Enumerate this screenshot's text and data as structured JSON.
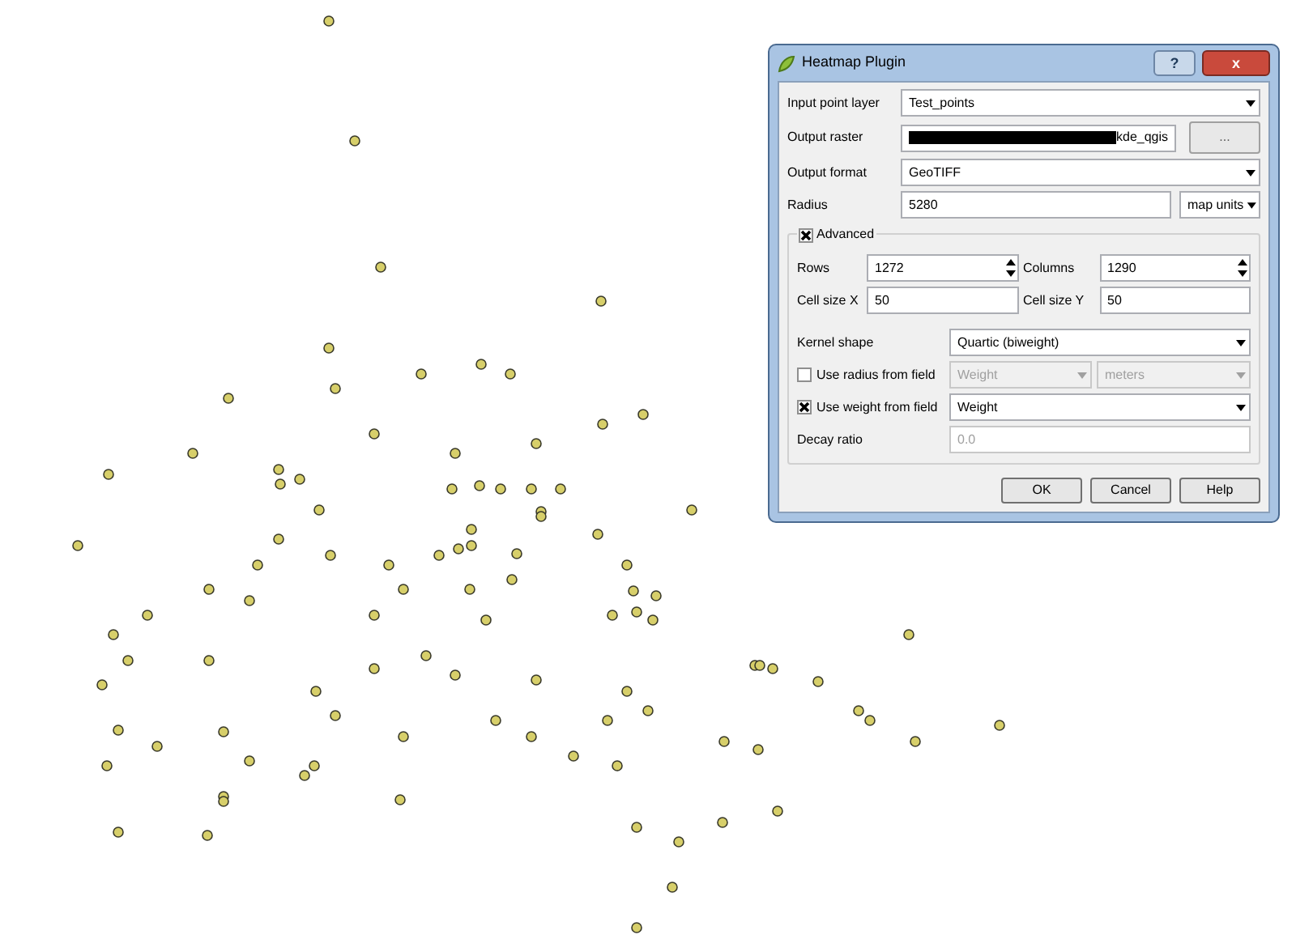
{
  "dialog": {
    "title": "Heatmap Plugin",
    "help_button": "?",
    "close_button": "x",
    "input_layer": {
      "label": "Input point layer",
      "value": "Test_points"
    },
    "output_raster": {
      "label": "Output raster",
      "value": "kde_qgis",
      "browse": "..."
    },
    "output_format": {
      "label": "Output format",
      "value": "GeoTIFF"
    },
    "radius": {
      "label": "Radius",
      "value": "5280",
      "units": "map units"
    },
    "advanced": {
      "label": "Advanced",
      "checked": true,
      "rows": {
        "label": "Rows",
        "value": "1272"
      },
      "columns": {
        "label": "Columns",
        "value": "1290"
      },
      "cell_x": {
        "label": "Cell size X",
        "value": "50"
      },
      "cell_y": {
        "label": "Cell size Y",
        "value": "50"
      },
      "kernel_shape": {
        "label": "Kernel shape",
        "value": "Quartic (biweight)"
      },
      "radius_field": {
        "label": "Use radius from field",
        "checked": false,
        "field": "Weight",
        "units": "meters"
      },
      "weight_field": {
        "label": "Use weight from field",
        "checked": true,
        "field": "Weight"
      },
      "decay_ratio": {
        "label": "Decay ratio",
        "value": "0.0",
        "disabled": true
      }
    },
    "buttons": [
      "OK",
      "Cancel",
      "Help"
    ]
  }
}
